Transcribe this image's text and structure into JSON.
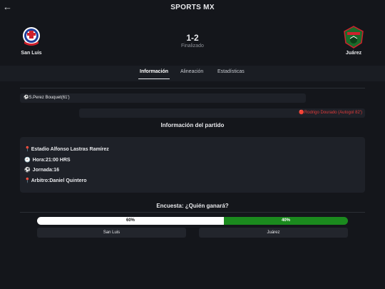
{
  "header": {
    "back_icon": "←",
    "title": "SPORTS MX"
  },
  "match": {
    "home_team": "San Luis",
    "away_team": "Juárez",
    "score": "1-2",
    "status": "Finalizado",
    "home_crest_text": "SAN LUIS",
    "away_crest_text": "JUÁREZ"
  },
  "tabs": [
    {
      "label": "Información",
      "active": true
    },
    {
      "label": "Alineación",
      "active": false
    },
    {
      "label": "Estadísticas",
      "active": false
    }
  ],
  "events": {
    "home": {
      "icon": "⚽",
      "text": "S.Perez Bouquet(61')"
    },
    "away": {
      "icon": "🔴",
      "text": "Rodrigo Dourado (Autogol 82')"
    }
  },
  "info": {
    "title": "Información del partido",
    "stadium": {
      "icon": "📍",
      "text": "Estadio Alfonso Lastras Ramírez"
    },
    "time": {
      "icon": "🕘",
      "text": "Hora:21:00 HRS"
    },
    "round": {
      "icon": "⚽",
      "text": "Jornada:16"
    },
    "referee": {
      "icon": "📍",
      "text": "Arbitro:Daniel Quintero"
    }
  },
  "poll": {
    "title": "Encuesta: ¿Quién ganará?",
    "home_pct_label": "60%",
    "away_pct_label": "40%",
    "home_fraction": 0.6,
    "home_button": "San Luis",
    "away_button": "Juárez"
  },
  "colors": {
    "background": "#14161b",
    "card": "#1e2128",
    "own_goal_red": "#e03a3a",
    "poll_home": "#ffffff",
    "poll_away": "#1b8a1e"
  }
}
